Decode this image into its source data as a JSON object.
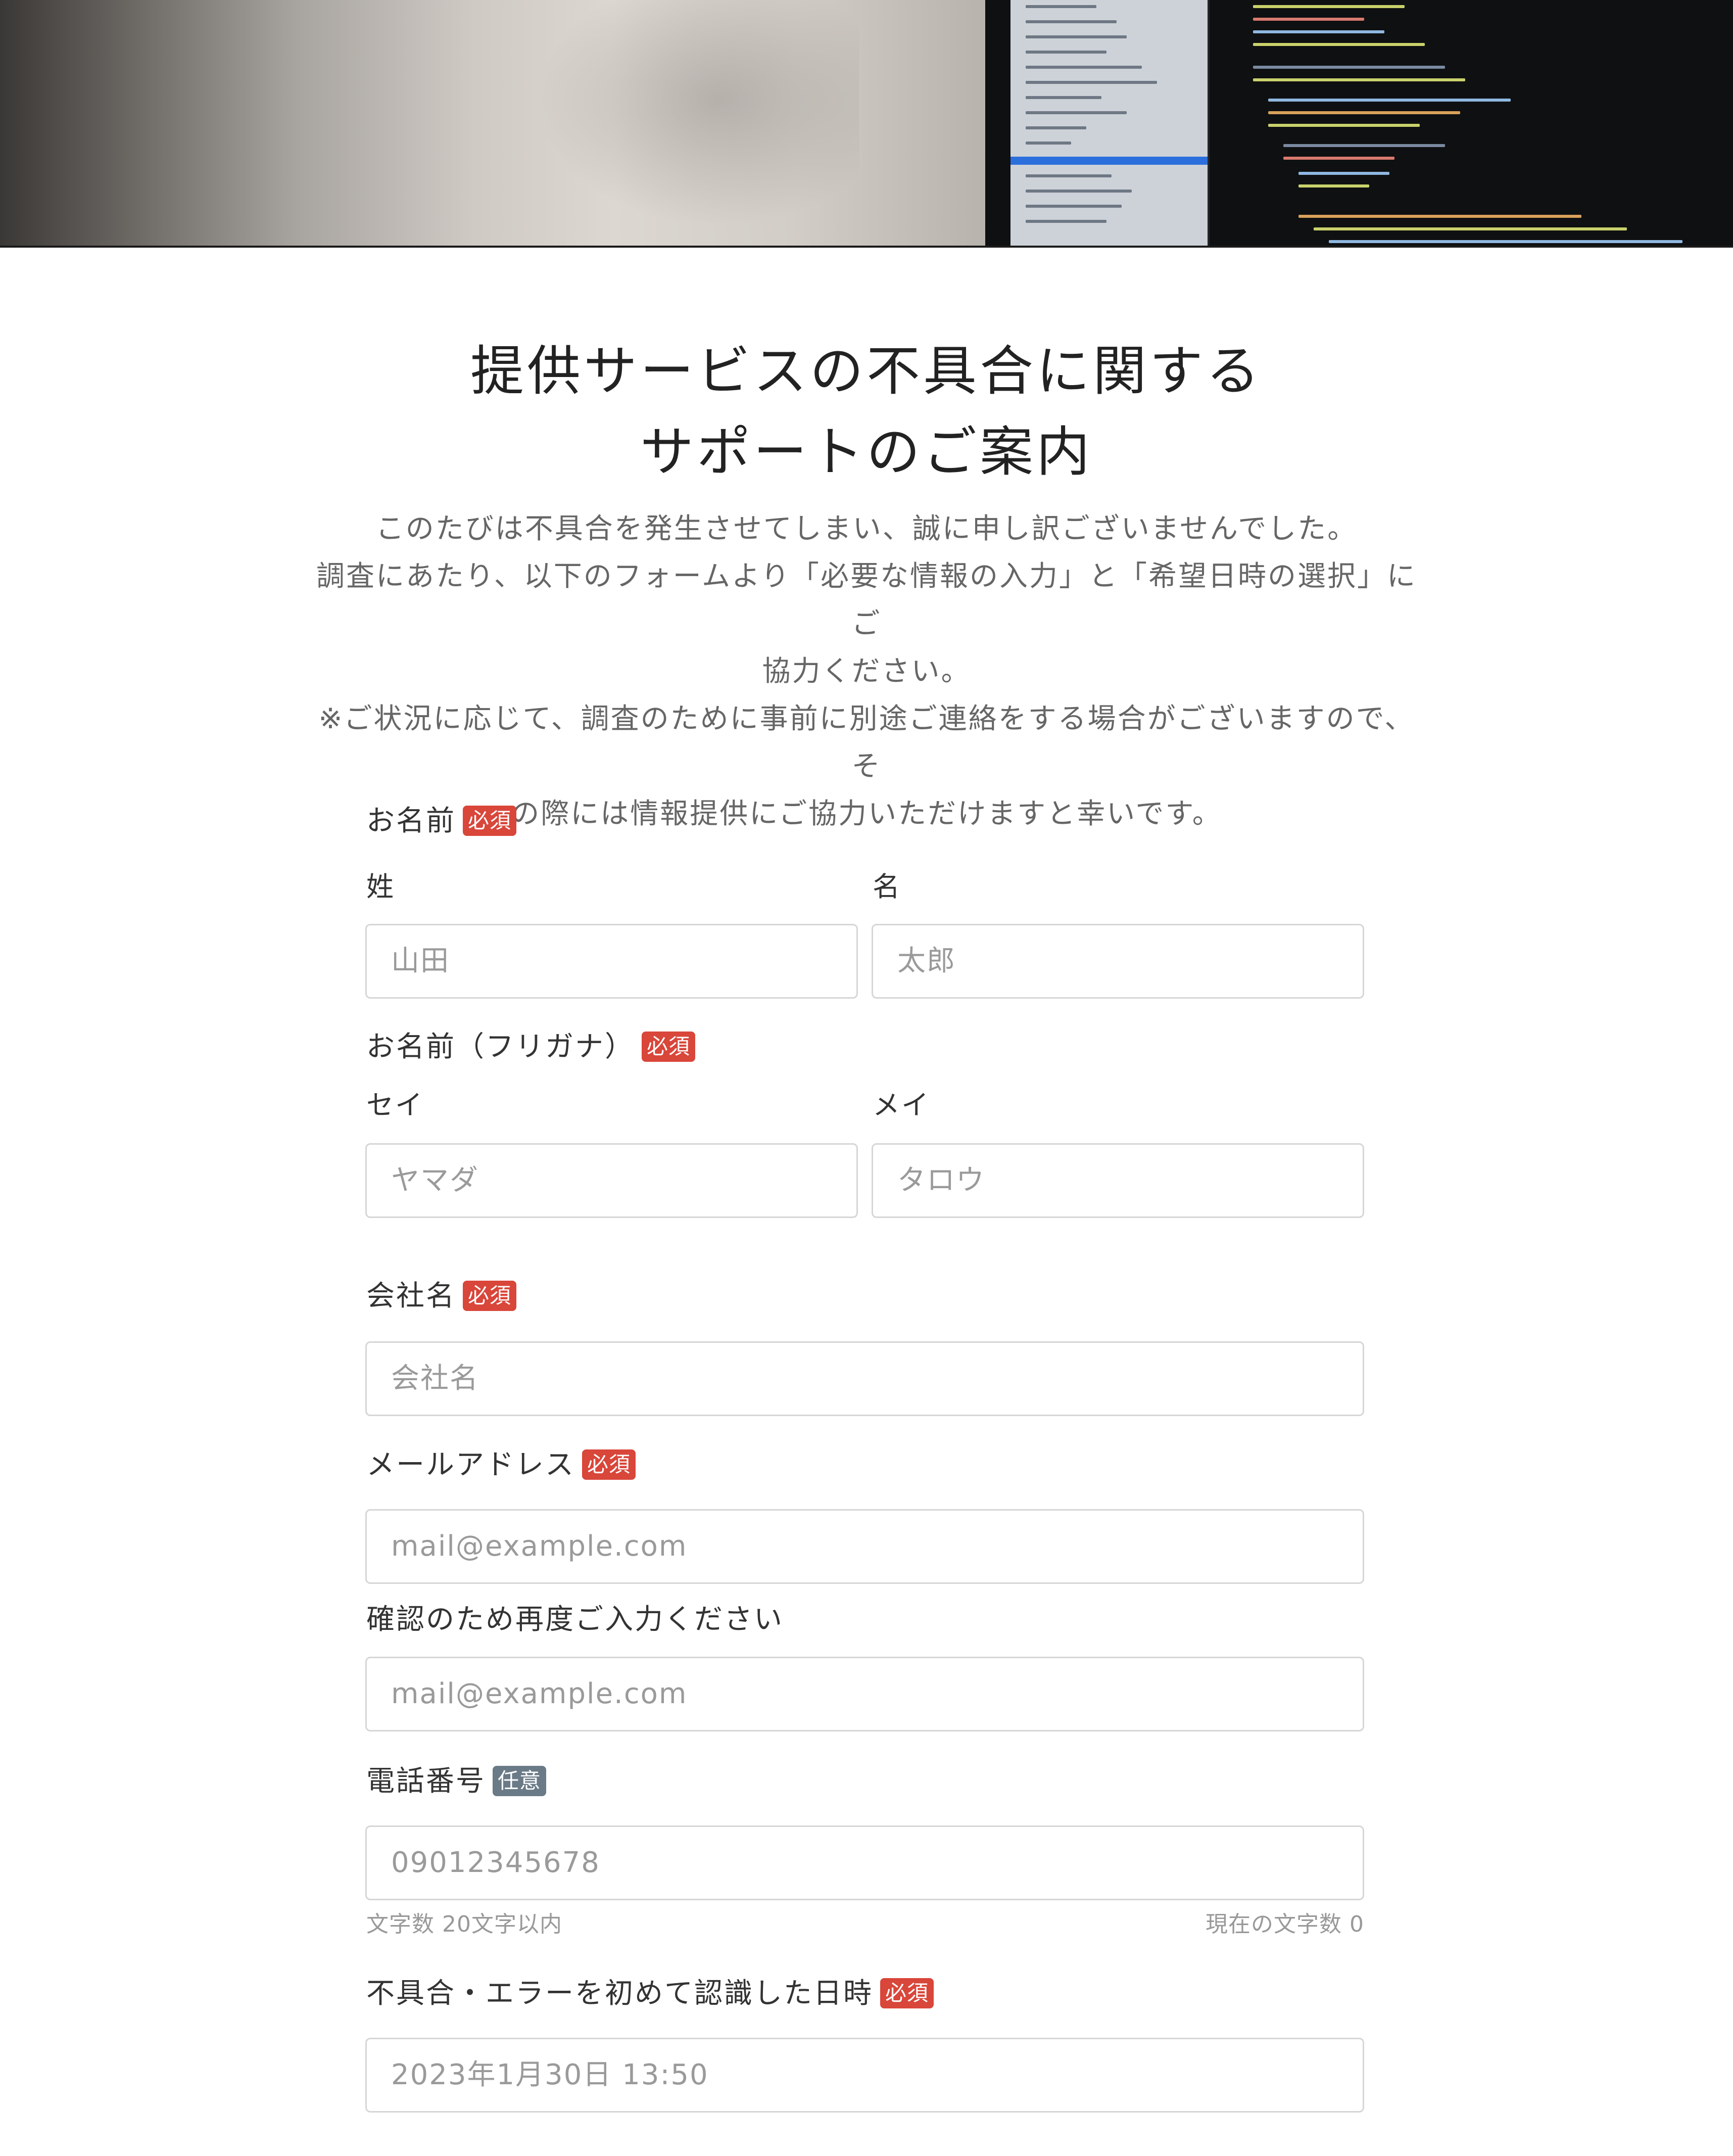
{
  "title": {
    "line1": "提供サービスの不具合に関する",
    "line2": "サポートのご案内"
  },
  "intro": {
    "line1": "このたびは不具合を発生させてしまい、誠に申し訳ございませんでした。",
    "line2": "調査にあたり、以下のフォームより「必要な情報の入力」と「希望日時の選択」にご",
    "line3": "協力ください。",
    "line4": "※ご状況に応じて、調査のために事前に別途ご連絡をする場合がございますので、そ",
    "line5": "の際には情報提供にご協力いただけますと幸いです。"
  },
  "badges": {
    "required": "必須",
    "optional": "任意"
  },
  "form": {
    "name": {
      "label": "お名前",
      "last_label": "姓",
      "last_placeholder": "山田",
      "first_label": "名",
      "first_placeholder": "太郎"
    },
    "kana": {
      "label": "お名前（フリガナ）",
      "last_label": "セイ",
      "last_placeholder": "ヤマダ",
      "first_label": "メイ",
      "first_placeholder": "タロウ"
    },
    "company": {
      "label": "会社名",
      "placeholder": "会社名"
    },
    "email": {
      "label": "メールアドレス",
      "placeholder": "mail@example.com",
      "confirm_label": "確認のため再度ご入力ください",
      "confirm_placeholder": "mail@example.com"
    },
    "phone": {
      "label": "電話番号",
      "placeholder": "09012345678",
      "limit_hint": "文字数 20文字以内",
      "count_hint": "現在の文字数 0"
    },
    "first_seen": {
      "label": "不具合・エラーを初めて認識した日時",
      "placeholder": "2023年1月30日 13:50"
    }
  }
}
